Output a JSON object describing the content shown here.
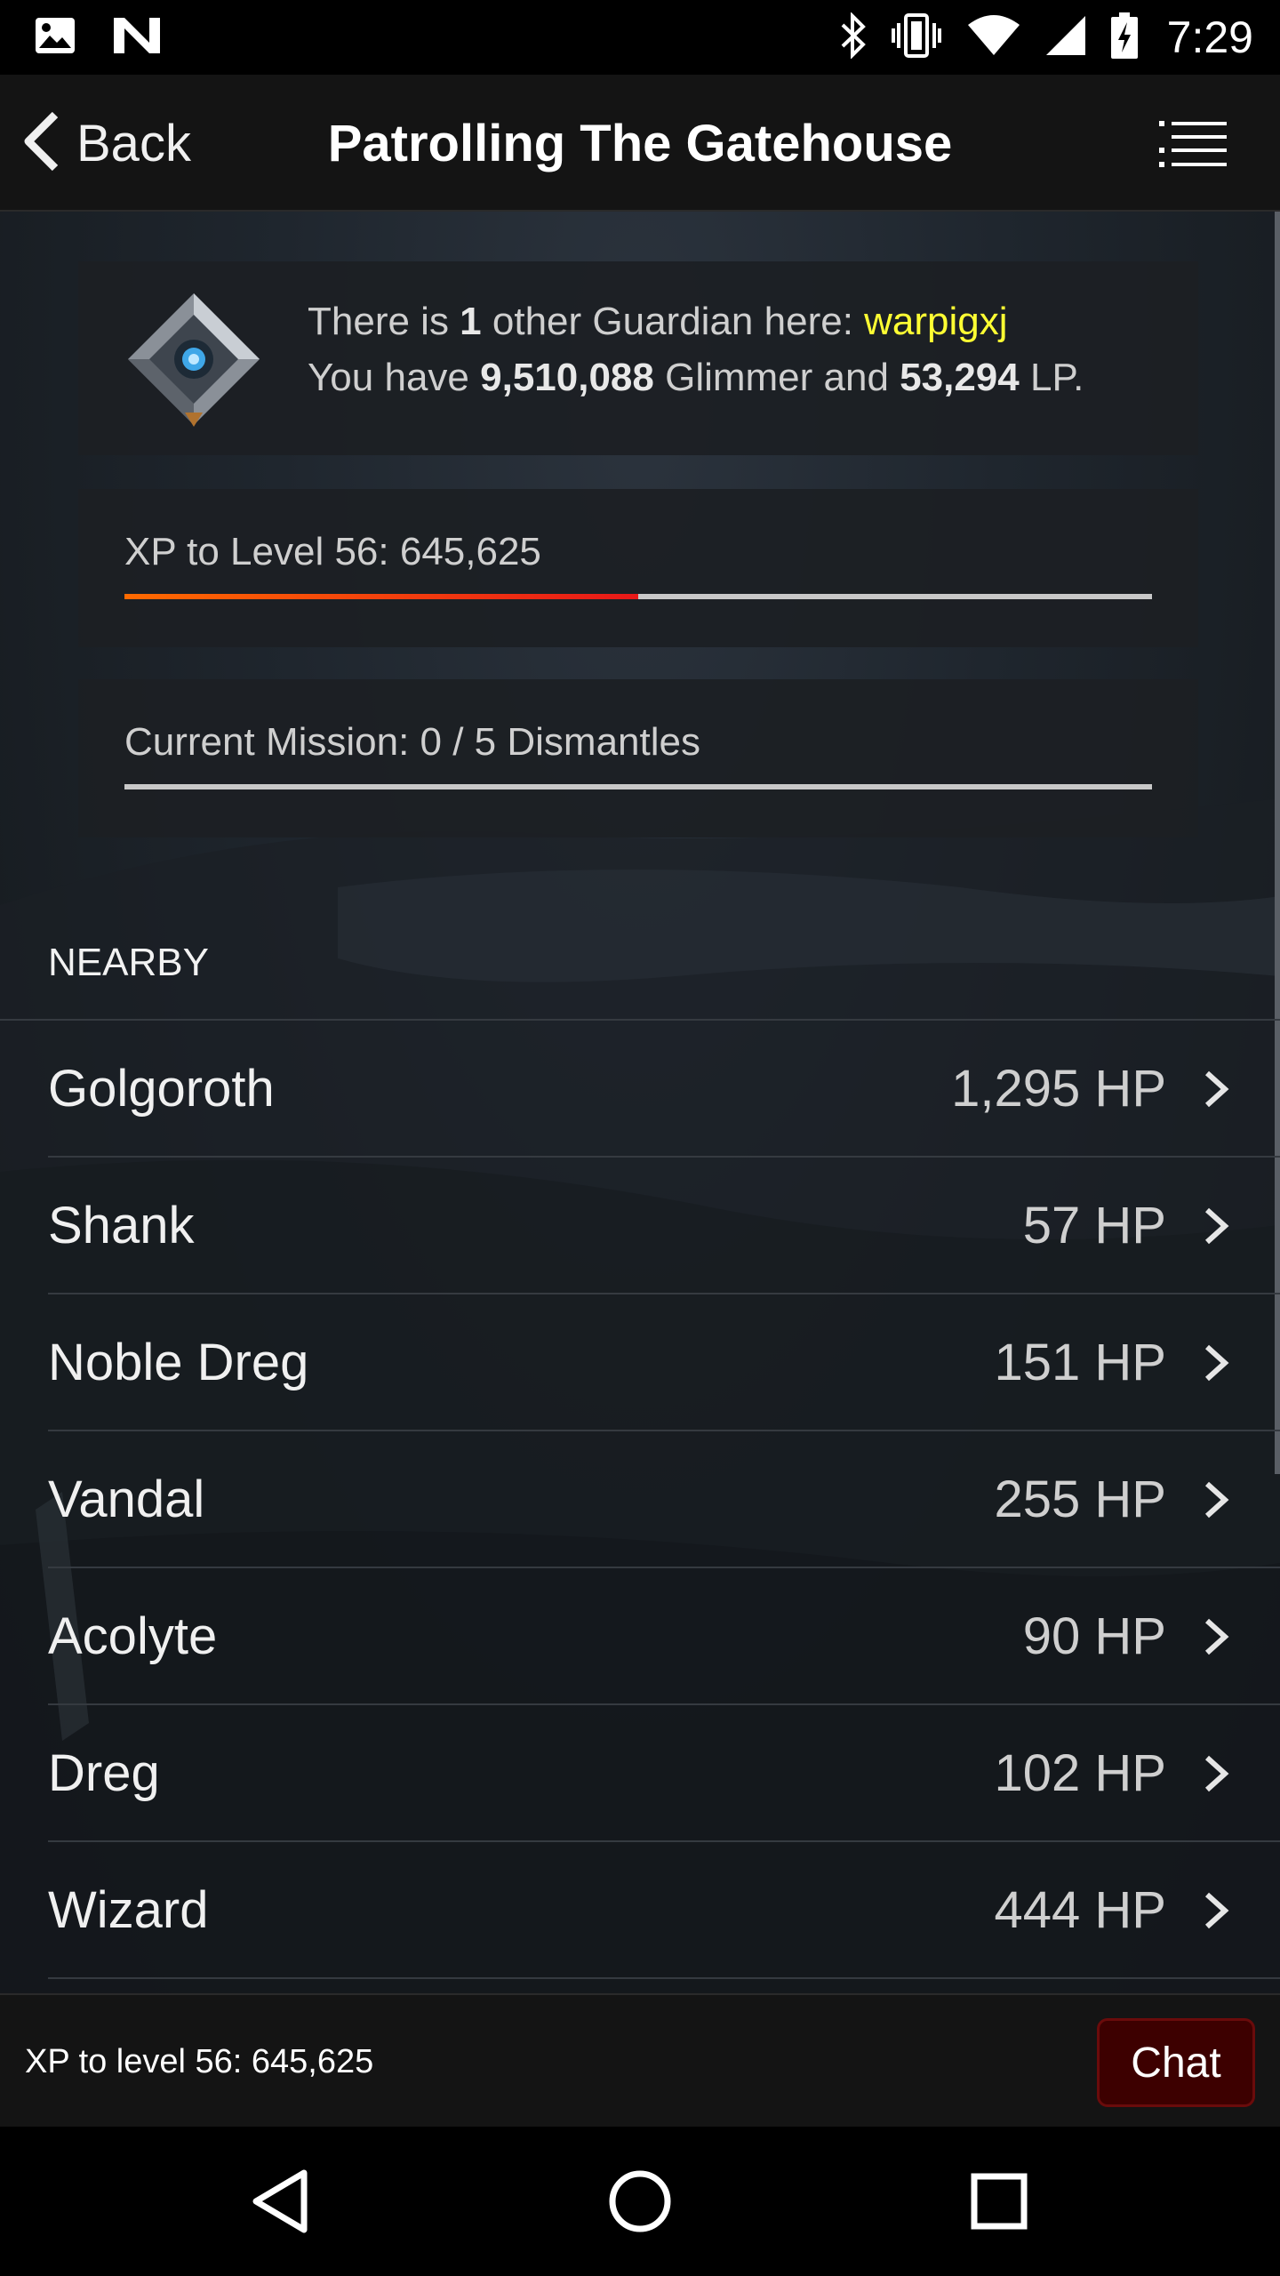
{
  "status_bar": {
    "time": "7:29",
    "icons": [
      "image-icon",
      "n-icon",
      "bluetooth-icon",
      "vibrate-icon",
      "wifi-icon",
      "signal-icon",
      "battery-charging-icon"
    ]
  },
  "header": {
    "back_label": "Back",
    "title": "Patrolling The Gatehouse",
    "menu_icon": "list-menu-icon"
  },
  "guardian": {
    "line1_pre": "There is ",
    "count": "1",
    "line1_mid": " other Guardian here: ",
    "name": "warpigxj",
    "line2_pre": "You have ",
    "glimmer": "9,510,088",
    "line2_mid": " Glimmer and ",
    "lp": "53,294",
    "line2_post": " LP."
  },
  "xp": {
    "label": "XP to Level 56: 645,625",
    "progress": 0.5
  },
  "mission": {
    "label": "Current Mission: 0 / 5 Dismantles",
    "progress": 0
  },
  "nearby": {
    "heading": "NEARBY",
    "items": [
      {
        "name": "Golgoroth",
        "hp": "1,295 HP"
      },
      {
        "name": "Shank",
        "hp": "57 HP"
      },
      {
        "name": "Noble Dreg",
        "hp": "151 HP"
      },
      {
        "name": "Vandal",
        "hp": "255 HP"
      },
      {
        "name": "Acolyte",
        "hp": "90 HP"
      },
      {
        "name": "Dreg",
        "hp": "102 HP"
      },
      {
        "name": "Wizard",
        "hp": "444 HP"
      }
    ]
  },
  "footer": {
    "xp_text": "XP to level 56: 645,625",
    "chat_label": "Chat"
  },
  "colors": {
    "accent_yellow": "#ffff33",
    "xp_bar_start": "#ff6a00",
    "xp_bar_end": "#e81818",
    "chat_bg": "#3d0000"
  }
}
